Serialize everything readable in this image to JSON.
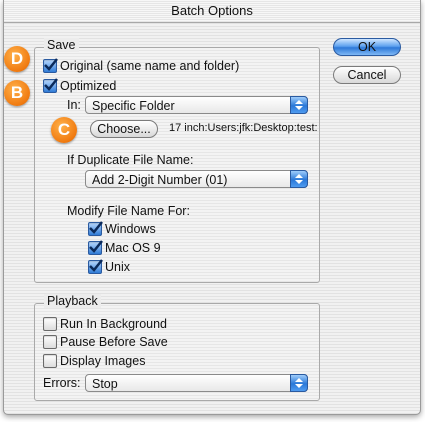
{
  "window": {
    "title": "Batch Options"
  },
  "buttons": {
    "ok": "OK",
    "cancel": "Cancel"
  },
  "save": {
    "legend": "Save",
    "original_label": "Original (same name and folder)",
    "optimized_label": "Optimized",
    "in_label": "In:",
    "in_value": "Specific Folder",
    "choose_button": "Choose...",
    "folder_path": "17 inch:Users:jfk:Desktop:test:",
    "duplicate_label": "If Duplicate File Name:",
    "duplicate_value": "Add 2-Digit Number (01)",
    "modify_label": "Modify File Name For:",
    "platforms": [
      "Windows",
      "Mac OS 9",
      "Unix"
    ]
  },
  "playback": {
    "legend": "Playback",
    "run_in_background": "Run In Background",
    "pause_before_save": "Pause Before Save",
    "display_images": "Display Images",
    "errors_label": "Errors:",
    "errors_value": "Stop"
  },
  "callouts": [
    "D",
    "B",
    "C"
  ],
  "colors": {
    "accent": "#2e79d8",
    "badge": "#f07a10"
  }
}
